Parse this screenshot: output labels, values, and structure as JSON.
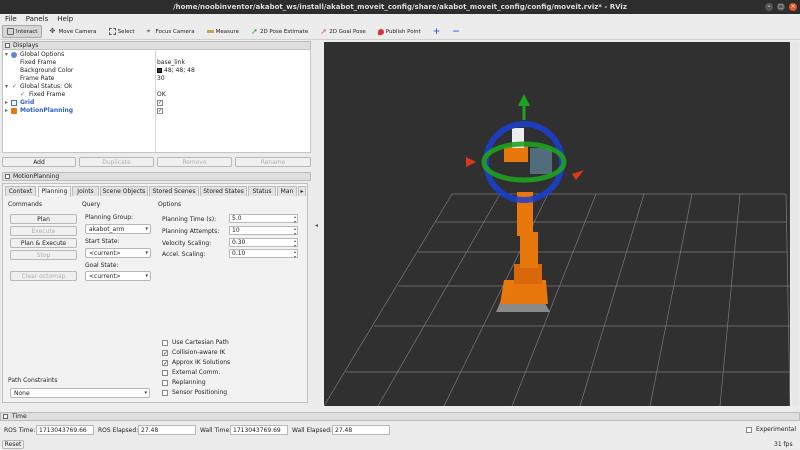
{
  "window": {
    "title": "/home/noobinventor/akabot_ws/install/akabot_moveit_config/share/akabot_moveit_config/config/moveit.rviz* - RViz"
  },
  "menu": {
    "file": "File",
    "panels": "Panels",
    "help": "Help"
  },
  "toolbar": {
    "interact": "Interact",
    "move_camera": "Move Camera",
    "select": "Select",
    "focus_camera": "Focus Camera",
    "measure": "Measure",
    "pose_estimate": "2D Pose Estimate",
    "goal_pose": "2D Goal Pose",
    "publish_point": "Publish Point",
    "plus": "+",
    "minus": "−"
  },
  "displays": {
    "title": "Displays",
    "global_options": "Global Options",
    "fixed_frame_label": "Fixed Frame",
    "fixed_frame_value": "base_link",
    "bg_color_label": "Background Color",
    "bg_color_value": "48; 48; 48",
    "bg_color_hex": "#303030",
    "frame_rate_label": "Frame Rate",
    "frame_rate_value": "30",
    "global_status": "Global Status: Ok",
    "status_fixed_frame": "Fixed Frame",
    "status_fixed_frame_value": "OK",
    "grid": "Grid",
    "motion_planning": "MotionPlanning",
    "check": "✓",
    "arrow_down": "▾",
    "arrow_right": "▸"
  },
  "display_buttons": {
    "add": "Add",
    "duplicate": "Duplicate",
    "remove": "Remove",
    "rename": "Rename"
  },
  "motion_planning": {
    "title": "MotionPlanning",
    "tabs": [
      "Context",
      "Planning",
      "Joints",
      "Scene Objects",
      "Stored Scenes",
      "Stored States",
      "Status",
      "Man"
    ],
    "tab_more": "▸",
    "commands_label": "Commands",
    "plan": "Plan",
    "execute": "Execute",
    "plan_execute": "Plan & Execute",
    "stop": "Stop",
    "clear_octomap": "Clear octomap",
    "query_label": "Query",
    "planning_group_label": "Planning Group:",
    "planning_group_value": "akabot_arm",
    "start_state_label": "Start State:",
    "start_state_value": "<current>",
    "goal_state_label": "Goal State:",
    "goal_state_value": "<current>",
    "options_label": "Options",
    "planning_time_label": "Planning Time (s):",
    "planning_time_value": "5.0",
    "planning_attempts_label": "Planning Attempts:",
    "planning_attempts_value": "10",
    "velocity_scaling_label": "Velocity Scaling:",
    "velocity_scaling_value": "0.30",
    "accel_scaling_label": "Accel. Scaling:",
    "accel_scaling_value": "0.10",
    "use_cartesian": "Use Cartesian Path",
    "collision_aware": "Collision-aware IK",
    "approx_ik": "Approx IK Solutions",
    "external_comm": "External Comm.",
    "replanning": "Replanning",
    "sensor_positioning": "Sensor Positioning",
    "path_constraints_label": "Path Constraints",
    "path_constraints_value": "None",
    "combo_arrow": "▾"
  },
  "time": {
    "title": "Time",
    "ros_time_label": "ROS Time:",
    "ros_time_value": "1713043769.66",
    "ros_elapsed_label": "ROS Elapsed:",
    "ros_elapsed_value": "27.48",
    "wall_time_label": "Wall Time:",
    "wall_time_value": "1713043769.69",
    "wall_elapsed_label": "Wall Elapsed:",
    "wall_elapsed_value": "27.48",
    "experimental": "Experimental"
  },
  "status": {
    "reset": "Reset",
    "fps": "31 fps"
  },
  "colors": {
    "robot": "#e8770c",
    "viewport_bg": "#303030",
    "ring_blue": "#1a3fd6",
    "ring_green": "#1fa21f",
    "arrow_red": "#d83a1a",
    "link_blue": "#2d5fc4"
  }
}
